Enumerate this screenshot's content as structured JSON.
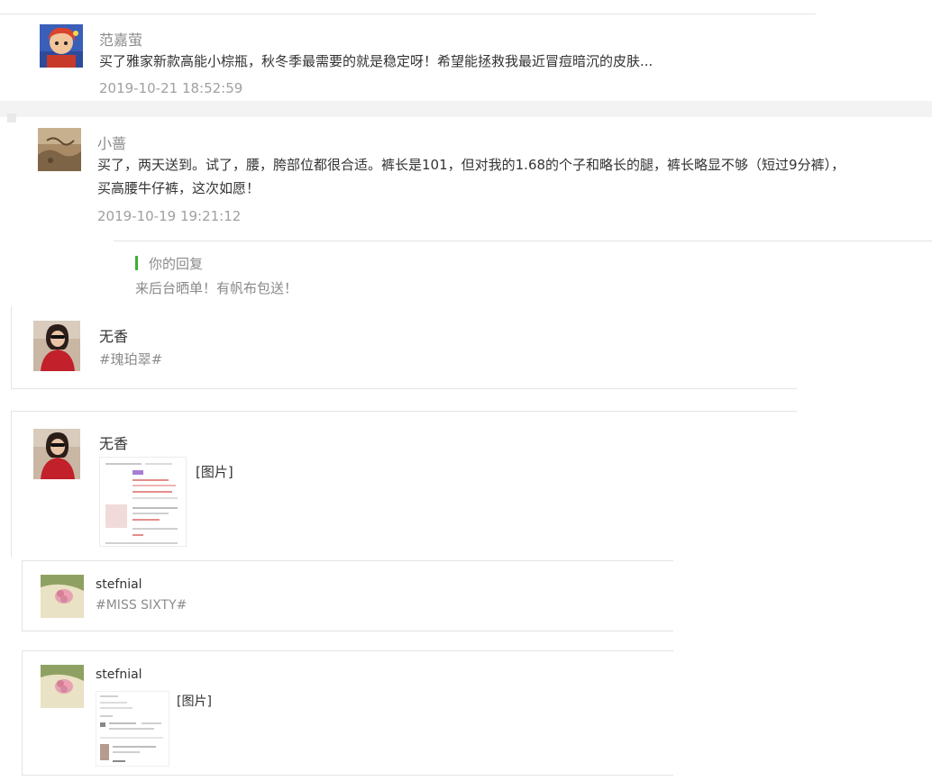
{
  "comments": [
    {
      "user": "范嘉萤",
      "text": "买了雅家新款高能小棕瓶，秋冬季最需要的就是稳定呀！希望能拯救我最近冒痘暗沉的皮肤...",
      "time": "2019-10-21 18:52:59"
    },
    {
      "user": "小蔷",
      "text_line1": "买了，两天送到。试了，腰，胯部位都很合适。裤长是101，但对我的1.68的个子和略长的腿，裤长略显不够（短过9分裤），",
      "text_line2": "买高腰牛仔裤，这次如愿！",
      "time": "2019-10-19 19:21:12",
      "reply": {
        "label": "你的回复",
        "text": "来后台晒单！有帆布包送！"
      }
    }
  ],
  "messages": [
    {
      "user": "无香",
      "tag": "#瑰珀翠#"
    },
    {
      "user": "无香",
      "image_label": "[图片]"
    },
    {
      "user": "stefnial",
      "tag": "#MISS SIXTY#"
    },
    {
      "user": "stefnial",
      "image_label": "[图片]"
    }
  ],
  "colors": {
    "reply_accent": "#3cb034",
    "divider": "#e3e3e3",
    "muted": "#a0a0a0"
  },
  "icons": [
    "avatar-anime",
    "avatar-landscape",
    "avatar-woman-red",
    "avatar-flower",
    "image-thumbnail"
  ]
}
